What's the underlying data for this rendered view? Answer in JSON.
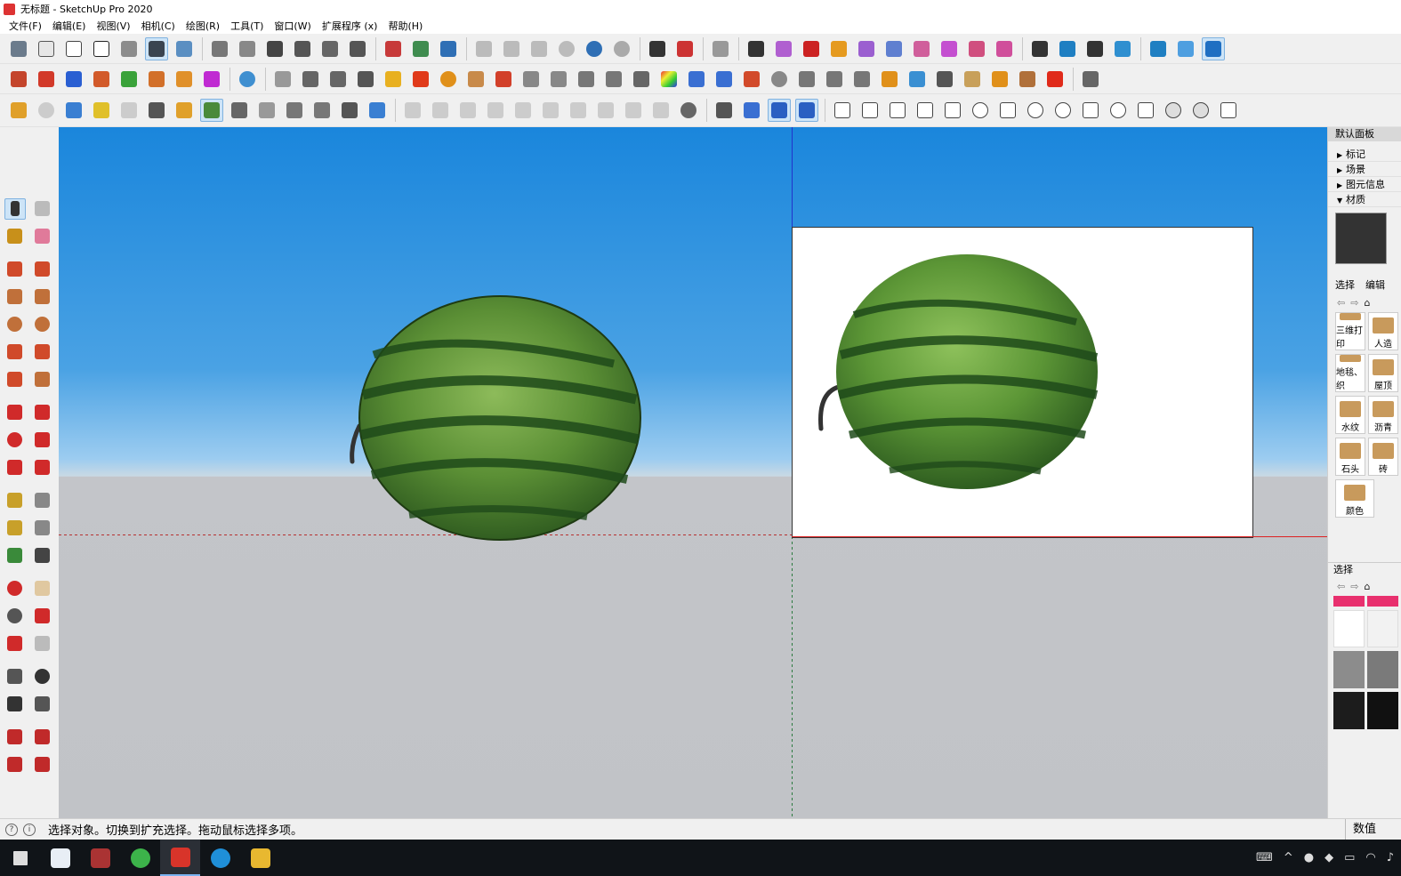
{
  "window": {
    "title": "无标题 - SketchUp Pro 2020"
  },
  "menu": [
    "文件(F)",
    "编辑(E)",
    "视图(V)",
    "相机(C)",
    "绘图(R)",
    "工具(T)",
    "窗口(W)",
    "扩展程序 (x)",
    "帮助(H)"
  ],
  "tray": {
    "title": "默认面板",
    "sections": [
      "标记",
      "场景",
      "图元信息",
      "材质"
    ],
    "tab_select": "选择",
    "tab_edit": "编辑",
    "library_items": [
      "三维打印",
      "人造",
      "地毯、织",
      "屋顶",
      "水纹",
      "沥青",
      "石头",
      "砖",
      "颜色"
    ],
    "bottom_title": "选择",
    "colors": [
      "#e8306e",
      "#ffffff",
      "#8c8c8c",
      "#1c1c1c"
    ]
  },
  "status": {
    "message": "选择对象。切换到扩充选择。拖动鼠标选择多项。",
    "measure_label": "数值"
  }
}
